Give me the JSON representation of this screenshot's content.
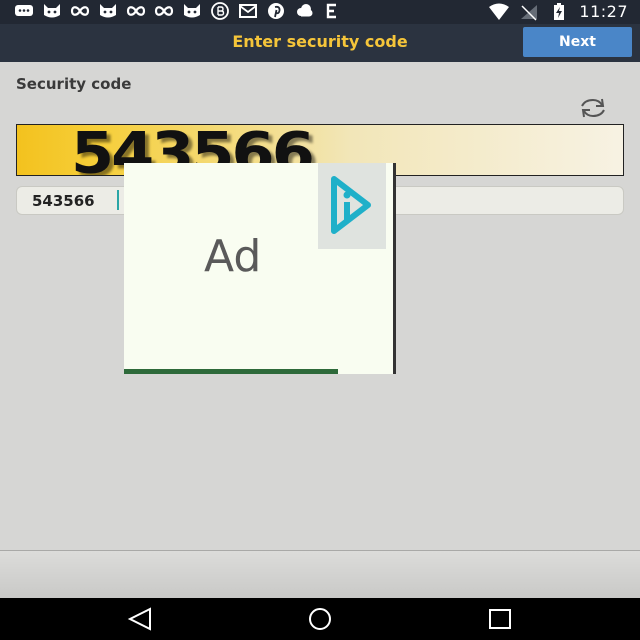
{
  "status_bar": {
    "time": "11:27",
    "notification_icons": [
      "chat-icon",
      "cat-icon",
      "infinity-icon",
      "cat-icon",
      "infinity-icon",
      "infinity-icon",
      "cat-icon",
      "b-bubble-icon",
      "mail-icon",
      "pinterest-icon",
      "cloud-icon",
      "e-icon"
    ],
    "right_icons": [
      "wifi-icon",
      "no-signal-icon",
      "battery-charging-icon"
    ]
  },
  "app_bar": {
    "title": "Enter security code",
    "next_label": "Next"
  },
  "form": {
    "section_label": "Security code",
    "captcha_text": "543566",
    "input_value": "543566"
  },
  "ad": {
    "label": "Ad"
  },
  "colors": {
    "app_bar_bg": "#2b3340",
    "title_color": "#f5c53a",
    "next_button_bg": "#4a86c8",
    "page_bg": "#d6d6d4",
    "ad_choices_accent": "#1fb0c9"
  }
}
